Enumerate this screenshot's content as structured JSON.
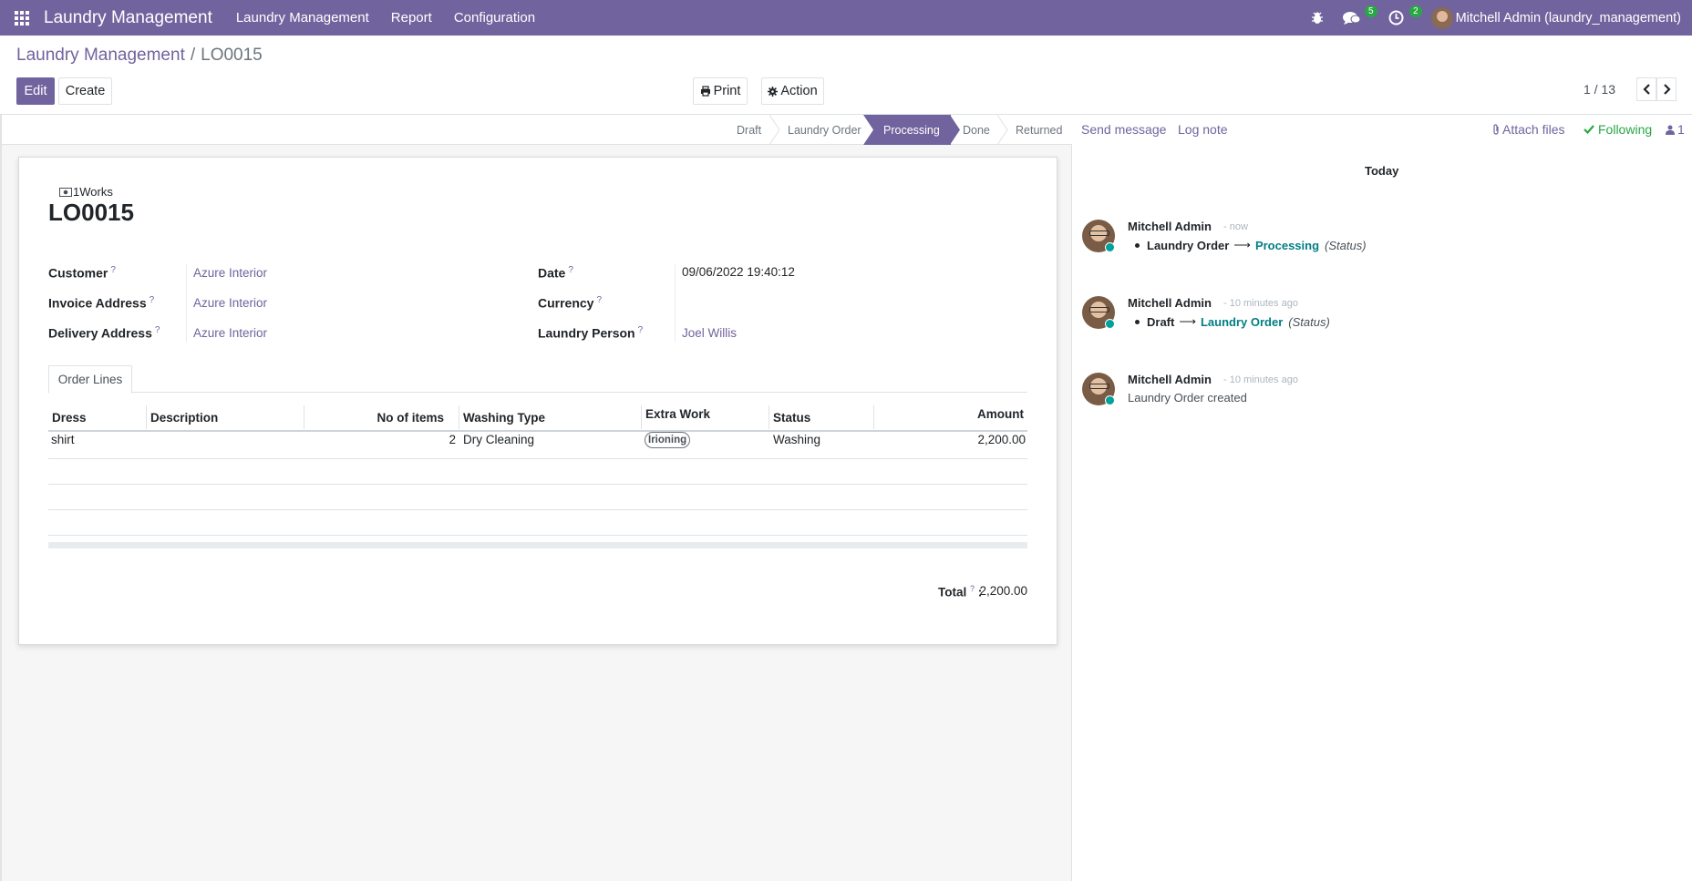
{
  "navbar": {
    "brand": "Laundry Management",
    "menu": [
      "Laundry Management",
      "Report",
      "Configuration"
    ],
    "messages_badge": "5",
    "activities_badge": "2",
    "user": "Mitchell Admin (laundry_management)"
  },
  "breadcrumb": {
    "parent": "Laundry Management",
    "separator": "/",
    "current": "LO0015"
  },
  "buttons": {
    "edit": "Edit",
    "create": "Create",
    "print": "Print",
    "action": "Action"
  },
  "pager": {
    "value": "1 / 13"
  },
  "stages": [
    {
      "label": "Draft",
      "active": false
    },
    {
      "label": "Laundry Order",
      "active": false
    },
    {
      "label": "Processing",
      "active": true
    },
    {
      "label": "Done",
      "active": false
    },
    {
      "label": "Returned",
      "active": false
    }
  ],
  "form": {
    "stat_button": "1Works",
    "title": "LO0015",
    "fields": {
      "customer": {
        "label": "Customer",
        "help": "?",
        "value": "Azure Interior"
      },
      "invoice_address": {
        "label": "Invoice Address",
        "help": "?",
        "value": "Azure Interior"
      },
      "delivery_address": {
        "label": "Delivery Address",
        "help": "?",
        "value": "Azure Interior"
      },
      "date": {
        "label": "Date",
        "help": "?",
        "value": "09/06/2022 19:40:12"
      },
      "currency": {
        "label": "Currency",
        "help": "?",
        "value": ""
      },
      "laundry_person": {
        "label": "Laundry Person",
        "help": "?",
        "value": "Joel Willis"
      }
    },
    "tab": "Order Lines",
    "columns": [
      "Dress",
      "Description",
      "No of items",
      "Washing Type",
      "Extra Work",
      "Status",
      "Amount"
    ],
    "rows": [
      {
        "dress": "shirt",
        "description": "",
        "items": "2",
        "washing_type": "Dry Cleaning",
        "extra_work": "Irioning",
        "status": "Washing",
        "amount": "2,200.00"
      }
    ],
    "total_label": "Total",
    "total_help": "?",
    "total_colon": ":",
    "total_value": "2,200.00"
  },
  "chatter": {
    "send_message": "Send message",
    "log_note": "Log note",
    "attach_files": "Attach files",
    "following": "Following",
    "followers": "1",
    "today": "Today",
    "messages": [
      {
        "author": "Mitchell Admin",
        "time": "- now",
        "old": "Laundry Order",
        "new": "Processing",
        "field": "(Status)"
      },
      {
        "author": "Mitchell Admin",
        "time": "- 10 minutes ago",
        "old": "Draft",
        "new": "Laundry Order",
        "field": "(Status)"
      },
      {
        "author": "Mitchell Admin",
        "time": "- 10 minutes ago",
        "body": "Laundry Order created"
      }
    ]
  }
}
